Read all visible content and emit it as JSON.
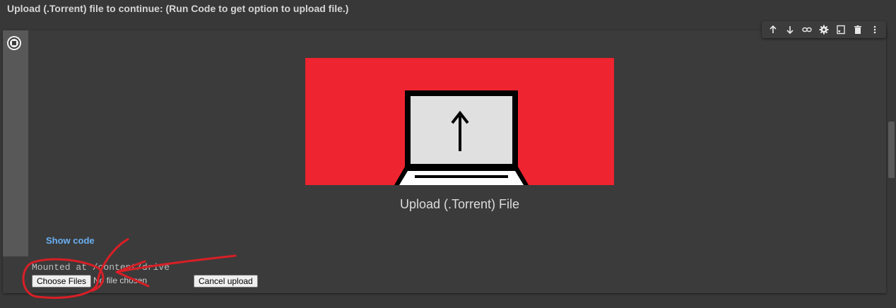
{
  "heading": "Upload (.Torrent) file to continue: (Run Code to get option to upload file.)",
  "toolbar": {
    "icons": [
      "arrow-up-icon",
      "arrow-down-icon",
      "link-icon",
      "gear-icon",
      "mirror-cell-icon",
      "trash-icon",
      "more-vert-icon"
    ]
  },
  "cell": {
    "upload_title": "Upload (.Torrent) File",
    "show_code_label": "Show code",
    "output_text": "Mounted at /content/drive",
    "choose_files_label": "Choose Files",
    "no_file_label": "No file chosen",
    "cancel_upload_label": "Cancel upload"
  },
  "colors": {
    "background": "#383838",
    "banner_red": "#ee2430",
    "link_blue": "#6ab0f3",
    "annotation_red": "#d81f26"
  }
}
